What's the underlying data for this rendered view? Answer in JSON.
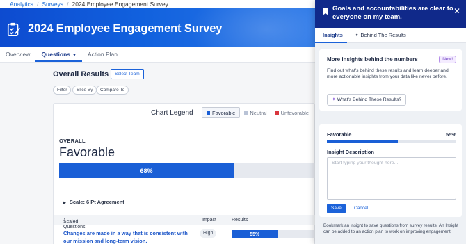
{
  "breadcrumb": {
    "items": [
      "Analytics",
      "Surveys"
    ],
    "current": "2024 Employee Engagement Survey"
  },
  "banner": {
    "title": "2024 Employee Engagement Survey",
    "icon": "survey-clipboard-icon"
  },
  "tabs": [
    {
      "label": "Overview"
    },
    {
      "label": "Questions"
    },
    {
      "label": "Action Plan"
    }
  ],
  "main": {
    "heading": "Overall Results",
    "select_team": "Select Team",
    "filters": [
      "Filter",
      "Slice By",
      "Compare To"
    ],
    "legend": {
      "title": "Chart Legend",
      "items": [
        {
          "label": "Favorable",
          "color": "#1a5fd6"
        },
        {
          "label": "Neutral",
          "color": "#b9c3d6"
        },
        {
          "label": "Unfavorable",
          "color": "#d9363e"
        }
      ]
    },
    "overall": {
      "label": "OVERALL",
      "category": "Favorable",
      "value_text": "68%",
      "value": 68
    },
    "scale_label": "Scale: 6 Pt Agreement",
    "table": {
      "headers": [
        "Scaled Questions",
        "Impact",
        "Results"
      ],
      "rows": [
        {
          "question": "Changes are made in a way that is consistent with our mission and long-term vision.",
          "impact": "High",
          "result_text": "55%",
          "result": 55
        }
      ]
    }
  },
  "panel": {
    "title": "Goals and accountabilities are clear to everyone on my team.",
    "tabs": [
      "Insights",
      "Behind The Results"
    ],
    "insight_card": {
      "heading": "More insights behind the numbers",
      "badge": "New!",
      "body": "Find out what's behind these results and learn deeper and more actionable insights from your data like never before.",
      "button": "What's Behind These Results?"
    },
    "form": {
      "metric_label": "Favorable",
      "metric_value_text": "55%",
      "metric_value": 55,
      "description_label": "Insight Description",
      "placeholder": "Start typing your thought here...",
      "save": "Save",
      "cancel": "Cancel"
    },
    "footer": "Bookmark an insight to save questions from survey results. An Insight can be added to an action plan to work on improving engagement."
  }
}
